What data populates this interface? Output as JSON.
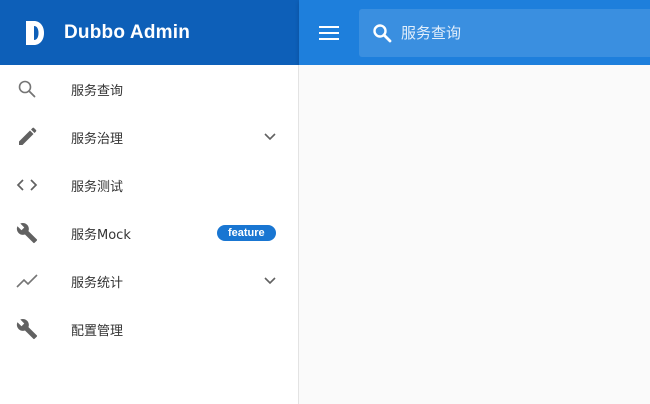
{
  "brand": {
    "title": "Dubbo Admin"
  },
  "topbar": {
    "search_placeholder": "服务查询"
  },
  "sidebar": {
    "items": [
      {
        "label": "服务查询",
        "icon": "search-icon"
      },
      {
        "label": "服务治理",
        "icon": "pencil-icon",
        "expandable": true
      },
      {
        "label": "服务测试",
        "icon": "code-icon"
      },
      {
        "label": "服务Mock",
        "icon": "wrench-icon",
        "badge": "feature"
      },
      {
        "label": "服务统计",
        "icon": "trending-icon",
        "expandable": true
      },
      {
        "label": "配置管理",
        "icon": "wrench-icon"
      }
    ]
  },
  "colors": {
    "brand_bg": "#0d5fb8",
    "topbar_bg": "#1e7fdc",
    "search_bg": "#3a8fe0",
    "badge_bg": "#1976d2",
    "content_bg": "#fafafa"
  }
}
